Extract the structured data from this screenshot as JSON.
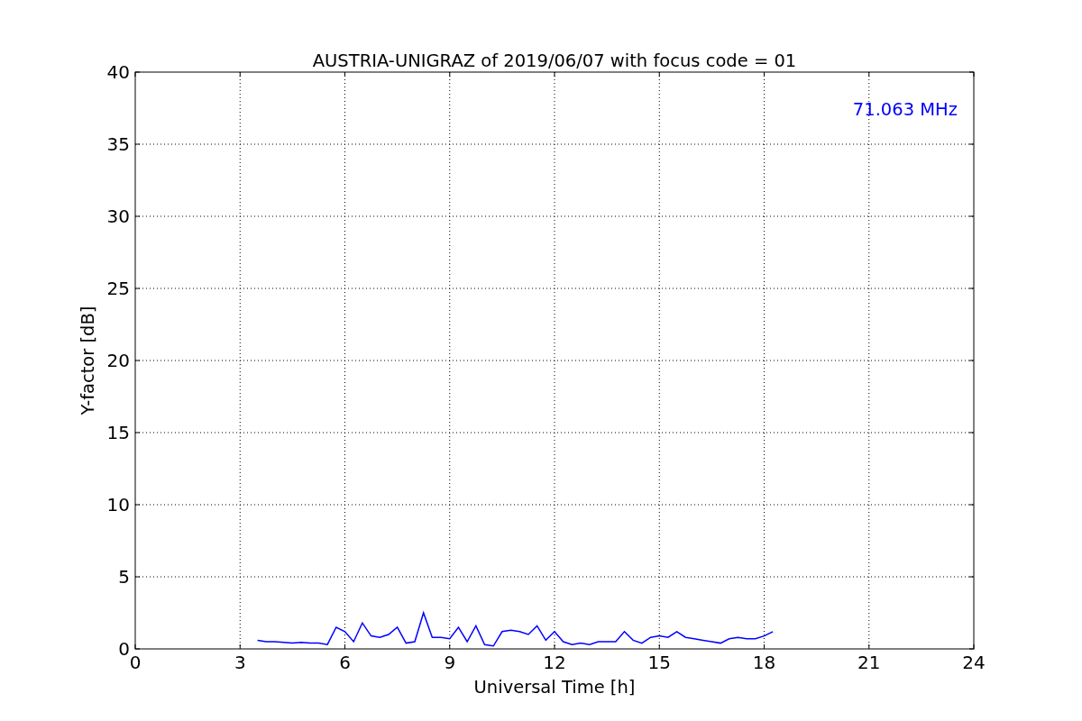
{
  "chart_data": {
    "type": "line",
    "title": "AUSTRIA-UNIGRAZ of 2019/06/07 with focus code = 01",
    "xlabel": "Universal Time [h]",
    "ylabel": "Y-factor [dB]",
    "x": [
      3.5,
      3.75,
      4,
      4.25,
      4.5,
      4.75,
      5,
      5.25,
      5.5,
      5.75,
      6,
      6.25,
      6.5,
      6.75,
      7,
      7.25,
      7.5,
      7.75,
      8,
      8.25,
      8.5,
      8.75,
      9,
      9.25,
      9.5,
      9.75,
      10,
      10.25,
      10.5,
      10.75,
      11,
      11.25,
      11.5,
      11.75,
      12,
      12.25,
      12.5,
      12.75,
      13,
      13.25,
      13.5,
      13.75,
      14,
      14.25,
      14.5,
      14.75,
      15,
      15.25,
      15.5,
      15.75,
      16,
      16.25,
      16.5,
      16.75,
      17,
      17.25,
      17.5,
      17.75,
      18,
      18.25
    ],
    "series": [
      {
        "name": "71.063 MHz",
        "color": "#0000ff",
        "values": [
          0.6,
          0.5,
          0.5,
          0.45,
          0.4,
          0.45,
          0.4,
          0.4,
          0.3,
          1.5,
          1.2,
          0.5,
          1.8,
          0.9,
          0.8,
          1.0,
          1.5,
          0.4,
          0.5,
          2.5,
          0.8,
          0.8,
          0.7,
          1.5,
          0.5,
          1.6,
          0.3,
          0.2,
          1.2,
          1.3,
          1.2,
          1.0,
          1.6,
          0.6,
          1.2,
          0.5,
          0.3,
          0.4,
          0.3,
          0.5,
          0.5,
          0.5,
          1.2,
          0.6,
          0.4,
          0.8,
          0.9,
          0.8,
          1.2,
          0.8,
          0.7,
          0.6,
          0.5,
          0.4,
          0.7,
          0.8,
          0.7,
          0.7,
          0.9,
          1.2
        ]
      }
    ],
    "grid": true,
    "xlim": [
      0,
      24
    ],
    "ylim": [
      0,
      40
    ],
    "xticks": [
      0,
      3,
      6,
      9,
      12,
      15,
      18,
      21,
      24
    ],
    "yticks": [
      0,
      5,
      10,
      15,
      20,
      25,
      30,
      35,
      40
    ]
  }
}
